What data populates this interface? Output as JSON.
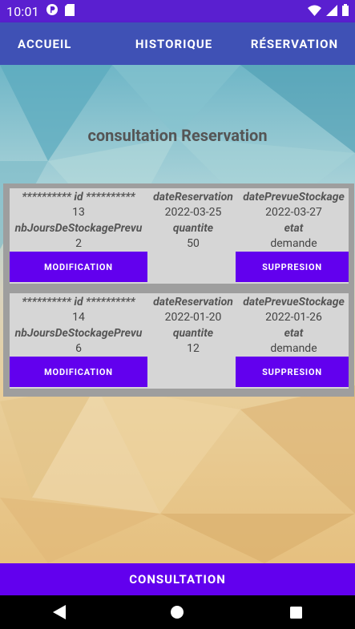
{
  "status_bar": {
    "time": "10:01"
  },
  "nav": {
    "home": "ACCUEIL",
    "history": "HISTORIQUE",
    "reservation": "RÉSERVATION"
  },
  "title": "consultation Reservation",
  "headers": {
    "id": "********** id **********",
    "date_reservation": "dateReservation",
    "date_prevue": "datePrevueStockage",
    "nb_jours": "nbJoursDeStockagePrevu",
    "quantite": "quantite",
    "etat": "etat"
  },
  "reservations": [
    {
      "id": "13",
      "date_reservation": "2022-03-25",
      "date_prevue": "2022-03-27",
      "nb_jours": "2",
      "quantite": "50",
      "etat": "demande",
      "modify_label": "MODIFICATION",
      "delete_label": "SUPPRESION"
    },
    {
      "id": "14",
      "date_reservation": "2022-01-20",
      "date_prevue": "2022-01-26",
      "nb_jours": "6",
      "quantite": "12",
      "etat": "demande",
      "modify_label": "MODIFICATION",
      "delete_label": "SUPPRESION"
    }
  ],
  "bottom_button": "CONSULTATION"
}
